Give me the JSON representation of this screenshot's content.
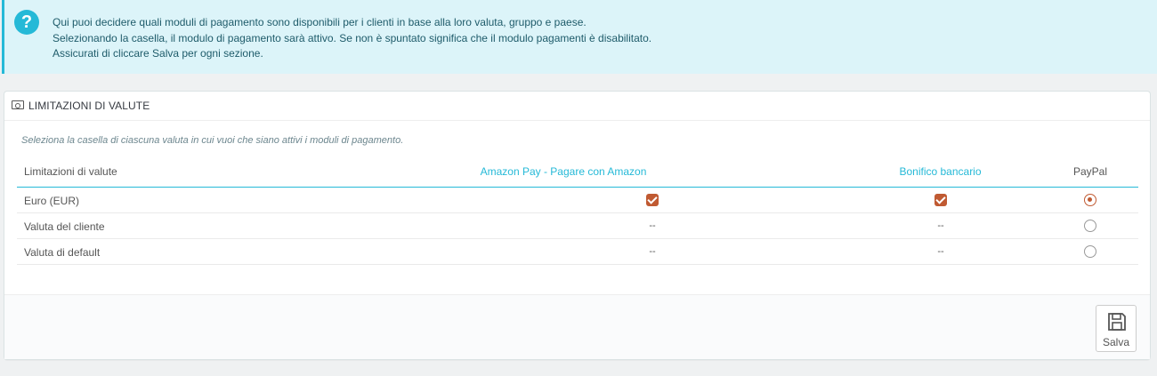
{
  "alert": {
    "lines": [
      "Qui puoi decidere quali moduli di pagamento sono disponibili per i clienti in base alla loro valuta, gruppo e paese.",
      "Selezionando la casella, il modulo di pagamento sarà attivo. Se non è spuntato significa che il modulo pagamenti è disabilitato.",
      "Assicurati di cliccare Salva per ogni sezione."
    ],
    "icon": "help-icon"
  },
  "panel": {
    "title": "LIMITAZIONI DI VALUTE",
    "icon": "money-icon",
    "description": "Seleziona la casella di ciascuna valuta in cui vuoi che siano attivi i moduli di pagamento.",
    "columns": [
      "Limitazioni di valute",
      "Amazon Pay - Pagare con Amazon",
      "Bonifico bancario",
      "PayPal"
    ],
    "rows": [
      {
        "label": "Euro (EUR)",
        "amazon": "checked",
        "bonifico": "checked",
        "paypal": "radio-checked"
      },
      {
        "label": "Valuta del cliente",
        "amazon": "--",
        "bonifico": "--",
        "paypal": "radio"
      },
      {
        "label": "Valuta di default",
        "amazon": "--",
        "bonifico": "--",
        "paypal": "radio"
      }
    ],
    "save_label": "Salva"
  },
  "colors": {
    "accent": "#25b9d7",
    "check": "#c05a32",
    "alert_bg": "#dcf4f9"
  }
}
